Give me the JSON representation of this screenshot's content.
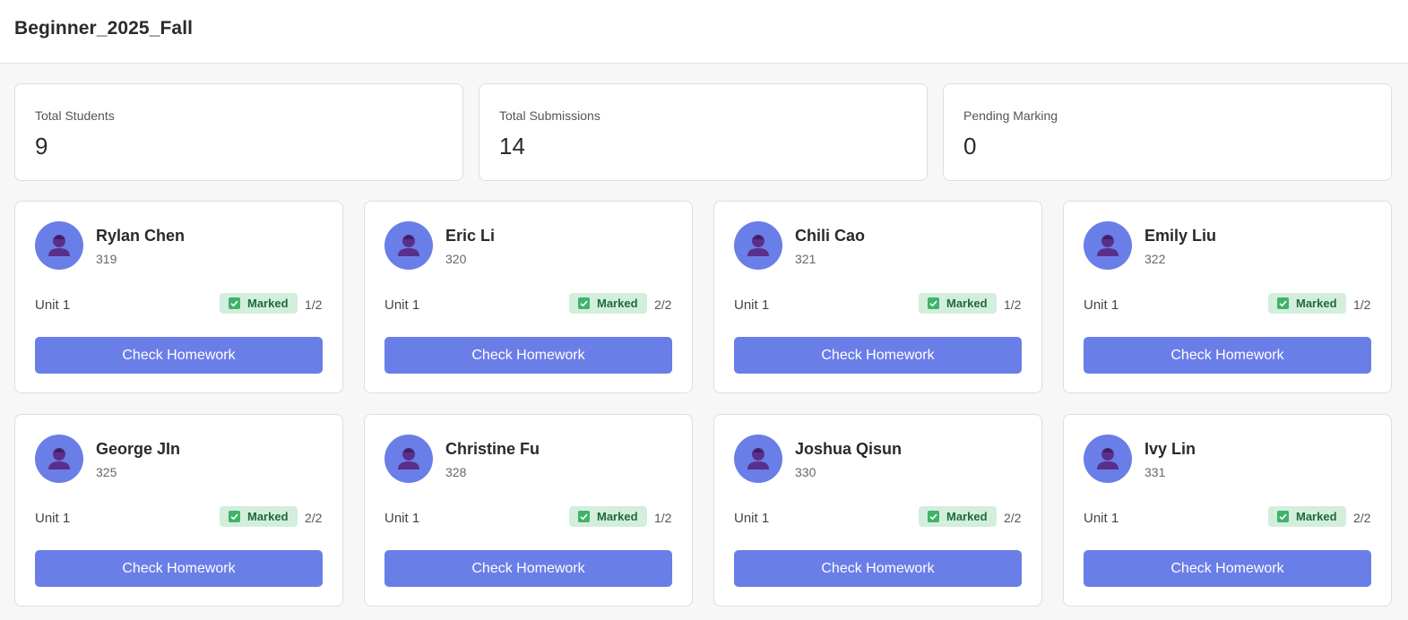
{
  "header": {
    "title": "Beginner_2025_Fall"
  },
  "stats": [
    {
      "label": "Total Students",
      "value": "9"
    },
    {
      "label": "Total Submissions",
      "value": "14"
    },
    {
      "label": "Pending Marking",
      "value": "0"
    }
  ],
  "colors": {
    "accent": "#6a7ee8",
    "badge_bg": "#d3eedc",
    "badge_text": "#1e6b3a",
    "badge_check": "#3fb36b"
  },
  "students": [
    {
      "name": "Rylan Chen",
      "id": "319",
      "unit": "Unit 1",
      "status": "Marked",
      "progress": "1/2",
      "button": "Check Homework",
      "avatar_icon": "user-avatar-icon"
    },
    {
      "name": "Eric Li",
      "id": "320",
      "unit": "Unit 1",
      "status": "Marked",
      "progress": "2/2",
      "button": "Check Homework",
      "avatar_icon": "user-avatar-icon"
    },
    {
      "name": "Chili Cao",
      "id": "321",
      "unit": "Unit 1",
      "status": "Marked",
      "progress": "1/2",
      "button": "Check Homework",
      "avatar_icon": "user-avatar-icon"
    },
    {
      "name": "Emily Liu",
      "id": "322",
      "unit": "Unit 1",
      "status": "Marked",
      "progress": "1/2",
      "button": "Check Homework",
      "avatar_icon": "user-avatar-icon"
    },
    {
      "name": "George JIn",
      "id": "325",
      "unit": "Unit 1",
      "status": "Marked",
      "progress": "2/2",
      "button": "Check Homework",
      "avatar_icon": "user-avatar-icon"
    },
    {
      "name": "Christine Fu",
      "id": "328",
      "unit": "Unit 1",
      "status": "Marked",
      "progress": "1/2",
      "button": "Check Homework",
      "avatar_icon": "user-avatar-icon"
    },
    {
      "name": "Joshua Qisun",
      "id": "330",
      "unit": "Unit 1",
      "status": "Marked",
      "progress": "2/2",
      "button": "Check Homework",
      "avatar_icon": "user-avatar-icon"
    },
    {
      "name": "Ivy Lin",
      "id": "331",
      "unit": "Unit 1",
      "status": "Marked",
      "progress": "2/2",
      "button": "Check Homework",
      "avatar_icon": "user-avatar-icon"
    }
  ]
}
